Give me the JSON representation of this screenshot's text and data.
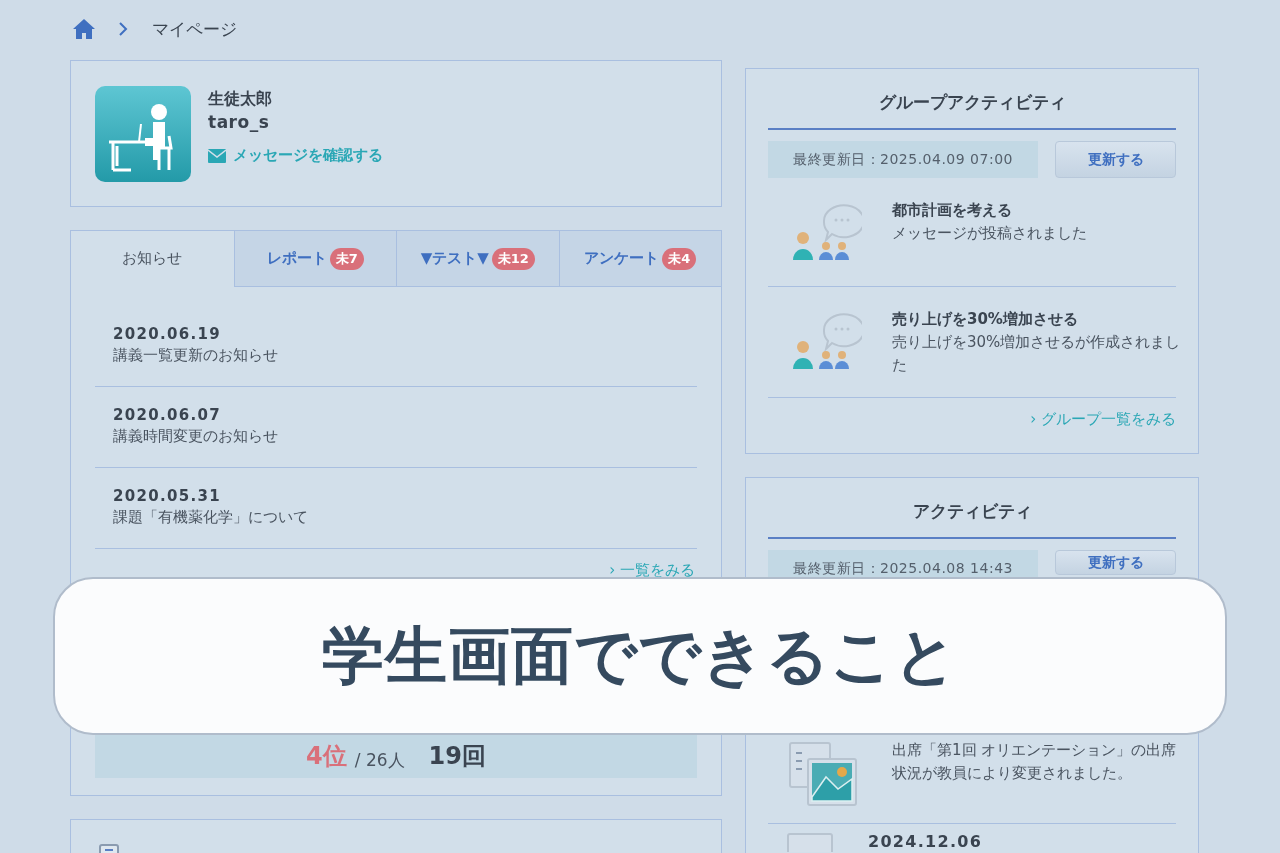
{
  "breadcrumb": {
    "items": [
      {
        "label": "マイページ"
      }
    ]
  },
  "profile": {
    "name": "生徒太郎",
    "username": "taro_s",
    "message_link": "メッセージを確認する"
  },
  "tabs": [
    {
      "label": "お知らせ",
      "selected": true
    },
    {
      "label": "レポート",
      "badge": "未7",
      "selected": false
    },
    {
      "label": "▼テスト▼",
      "badge": "未12",
      "selected": false
    },
    {
      "label": "アンケート",
      "badge": "未4",
      "selected": false
    }
  ],
  "notices": [
    {
      "date": "2020.06.19",
      "title": "講義一覧更新のお知らせ"
    },
    {
      "date": "2020.06.07",
      "title": "講義時間変更のお知らせ"
    },
    {
      "date": "2020.05.31",
      "title": "課題「有機薬化学」について"
    }
  ],
  "notices_more": "› 一覧をみる",
  "ranking": {
    "rank": "4位",
    "total": "/ 26人",
    "count": "19回"
  },
  "group_activity": {
    "title": "グループアクティビティ",
    "updated": "最終更新日：2025.04.09 07:00",
    "refresh_button": "更新する",
    "items": [
      {
        "title": "都市計画を考える",
        "message": "メッセージが投稿されました"
      },
      {
        "title": "売り上げを30%増加させる",
        "message": "売り上げを30%増加させるが作成されました"
      }
    ],
    "more": "› グループ一覧をみる"
  },
  "activity": {
    "title": "アクティビティ",
    "updated": "最終更新日：2025.04.08 14:43",
    "refresh_button": "更新する",
    "items": [
      {
        "kind": "attendance",
        "message": "出席「第1回 オリエンテーション」の出席状況が教員により変更されました。"
      },
      {
        "kind": "document",
        "date": "2024.12.06"
      }
    ]
  },
  "banner": {
    "text": "学生画面でできること"
  }
}
